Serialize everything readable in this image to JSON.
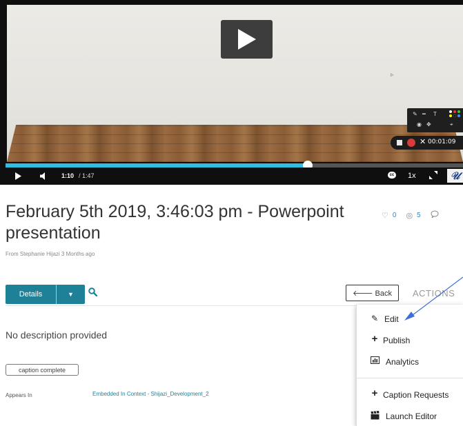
{
  "player": {
    "current_time": "1:10",
    "duration": "/ 1:47",
    "progress_fraction": 0.66,
    "speed": "1x",
    "cc_label": "cc",
    "logo_letter": "𝒰",
    "recorder": {
      "close_symbol": "✕",
      "time": "00:01:09"
    },
    "colors": {
      "progress": "#32bce0",
      "record": "#d93a3a"
    }
  },
  "entry": {
    "title": "February 5th 2019, 3:46:03 pm - Powerpoint presentation",
    "likes": "0",
    "views": "5",
    "from": "From Stephanie Hijazi 3 Months ago"
  },
  "toolbar": {
    "details_label": "Details",
    "caret": "▼",
    "back_label": "Back",
    "actions_label": "ACTIONS"
  },
  "details": {
    "description": "No description provided",
    "tag": "caption complete",
    "appears_label": "Appears In",
    "appears_link": "Embedded In Context - Shijazi_Development_2"
  },
  "actions_menu": {
    "items": [
      {
        "label": "Edit",
        "icon": "pencil-icon"
      },
      {
        "label": "Publish",
        "icon": "plus-icon"
      },
      {
        "label": "Analytics",
        "icon": "bar-chart-icon"
      },
      {
        "label": "Caption Requests",
        "icon": "plus-icon"
      },
      {
        "label": "Launch Editor",
        "icon": "clapperboard-icon"
      }
    ]
  },
  "accent_color": "#1f8197",
  "annotation_color": "#3f6fd6"
}
